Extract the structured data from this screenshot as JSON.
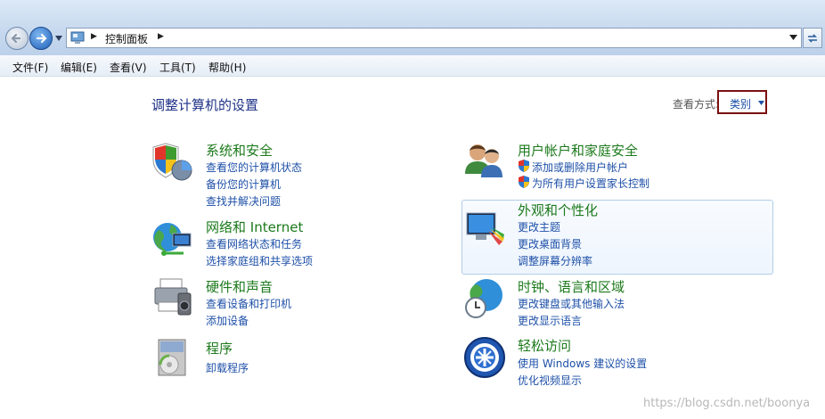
{
  "addressbar": {
    "breadcrumb": "控制面板",
    "arrow": "▶"
  },
  "menu": {
    "items": [
      "文件(F)",
      "编辑(E)",
      "查看(V)",
      "工具(T)",
      "帮助(H)"
    ]
  },
  "content": {
    "title": "调整计算机的设置",
    "view_by_label": "查看方式:",
    "view_by_value": "类别"
  },
  "categories": [
    {
      "title": "系统和安全",
      "links": [
        "查看您的计算机状态",
        "备份您的计算机",
        "查找并解决问题"
      ]
    },
    {
      "title": "网络和 Internet",
      "links": [
        "查看网络状态和任务",
        "选择家庭组和共享选项"
      ]
    },
    {
      "title": "硬件和声音",
      "links": [
        "查看设备和打印机",
        "添加设备"
      ]
    },
    {
      "title": "程序",
      "links": [
        "卸载程序"
      ]
    },
    {
      "title": "用户帐户和家庭安全",
      "links": [
        "添加或删除用户帐户",
        "为所有用户设置家长控制"
      ]
    },
    {
      "title": "外观和个性化",
      "links": [
        "更改主题",
        "更改桌面背景",
        "调整屏幕分辨率"
      ]
    },
    {
      "title": "时钟、语言和区域",
      "links": [
        "更改键盘或其他输入法",
        "更改显示语言"
      ]
    },
    {
      "title": "轻松访问",
      "links": [
        "使用 Windows 建议的设置",
        "优化视频显示"
      ]
    }
  ],
  "watermark": "https://blog.csdn.net/boonya",
  "colors": {
    "category_title": "#1c7a1c",
    "link": "#1e50a8",
    "page_title": "#1e3287",
    "view_select_border": "#7a1010"
  }
}
